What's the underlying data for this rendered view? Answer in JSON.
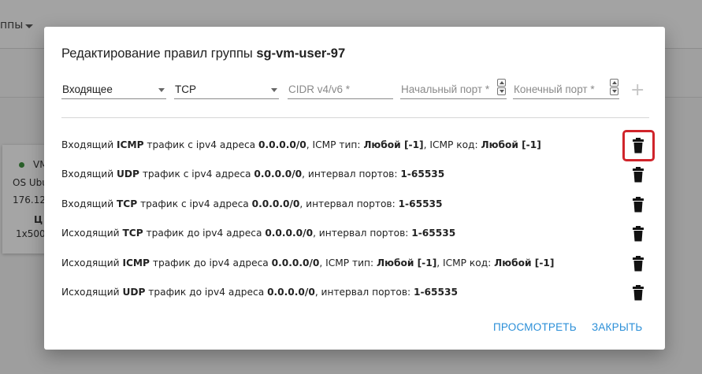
{
  "background": {
    "menu_label": "ппы",
    "card": {
      "name": "VM",
      "os": "OS Ubu",
      "ip": "176.12",
      "price_label": "Ц",
      "config": "1x500"
    }
  },
  "dialog": {
    "title_prefix": "Редактирование правил группы",
    "group_name": "sg-vm-user-97",
    "form": {
      "direction_value": "Входящее",
      "protocol_value": "TCP",
      "cidr_placeholder": "CIDR v4/v6 *",
      "start_port_placeholder": "Начальный порт *",
      "end_port_placeholder": "Конечный порт *",
      "add_symbol": "+"
    },
    "rules": [
      {
        "dir": "Входящий",
        "proto": "ICMP",
        "mid": "трафик с ipv4 адреса",
        "addr": "0.0.0.0/0",
        "t1": ", ICMP тип:",
        "v1": "Любой [-1]",
        "t2": ", ICMP код:",
        "v2": "Любой [-1]"
      },
      {
        "dir": "Входящий",
        "proto": "UDP",
        "mid": "трафик с ipv4 адреса",
        "addr": "0.0.0.0/0",
        "t1": ", интервал портов:",
        "v1": "1-65535",
        "t2": "",
        "v2": ""
      },
      {
        "dir": "Входящий",
        "proto": "TCP",
        "mid": "трафик с ipv4 адреса",
        "addr": "0.0.0.0/0",
        "t1": ", интервал портов:",
        "v1": "1-65535",
        "t2": "",
        "v2": ""
      },
      {
        "dir": "Исходящий",
        "proto": "TCP",
        "mid": "трафик до ipv4 адреса",
        "addr": "0.0.0.0/0",
        "t1": ", интервал портов:",
        "v1": "1-65535",
        "t2": "",
        "v2": ""
      },
      {
        "dir": "Исходящий",
        "proto": "ICMP",
        "mid": "трафик до ipv4 адреса",
        "addr": "0.0.0.0/0",
        "t1": ", ICMP тип:",
        "v1": "Любой [-1]",
        "t2": ", ICMP код:",
        "v2": "Любой [-1]"
      },
      {
        "dir": "Исходящий",
        "proto": "UDP",
        "mid": "трафик до ipv4 адреса",
        "addr": "0.0.0.0/0",
        "t1": ", интервал портов:",
        "v1": "1-65535",
        "t2": "",
        "v2": ""
      }
    ],
    "view_button": "ПРОСМОТРЕТЬ",
    "close_button": "ЗАКРЫТЬ"
  },
  "colors": {
    "accent": "#2b8fd8",
    "highlight": "#d0242b",
    "status_online": "#3d8b3d"
  },
  "icons": {
    "delete": "trash-icon",
    "add": "plus-icon"
  }
}
